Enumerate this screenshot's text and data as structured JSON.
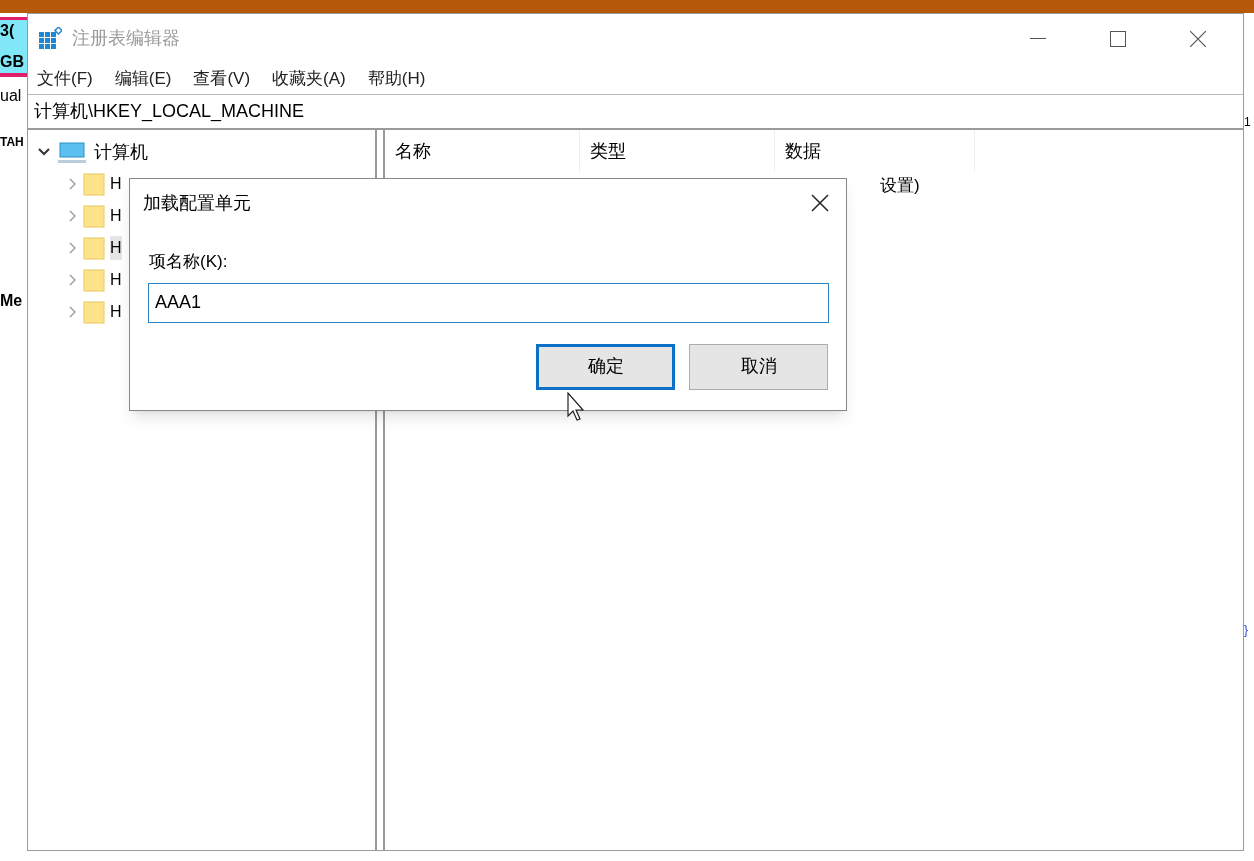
{
  "background_window": {
    "left_texts": [
      "3(",
      "GB",
      "ual",
      "TAH",
      "Me"
    ],
    "right_texts": [
      "1",
      "}"
    ]
  },
  "window": {
    "title": "注册表编辑器"
  },
  "menu": [
    "文件(F)",
    "编辑(E)",
    "查看(V)",
    "收藏夹(A)",
    "帮助(H)"
  ],
  "address": "计算机\\HKEY_LOCAL_MACHINE",
  "tree": [
    {
      "label": "计算机",
      "expanded": true,
      "selected": false,
      "children": [
        {
          "label": "H",
          "expanded": false,
          "selected": false
        },
        {
          "label": "H",
          "expanded": false,
          "selected": false
        },
        {
          "label": "H",
          "expanded": false,
          "selected": true
        },
        {
          "label": "H",
          "expanded": false,
          "selected": false
        },
        {
          "label": "H",
          "expanded": false,
          "selected": false
        }
      ]
    }
  ],
  "list": {
    "columns": [
      "名称",
      "类型",
      "数据"
    ],
    "rows": [
      {
        "data": "设置)"
      }
    ]
  },
  "dialog": {
    "title": "加载配置单元",
    "field_label": "项名称(K):",
    "field_value": "AAA1",
    "buttons": [
      {
        "label": "确定",
        "default": true
      },
      {
        "label": "取消",
        "default": false
      }
    ]
  }
}
